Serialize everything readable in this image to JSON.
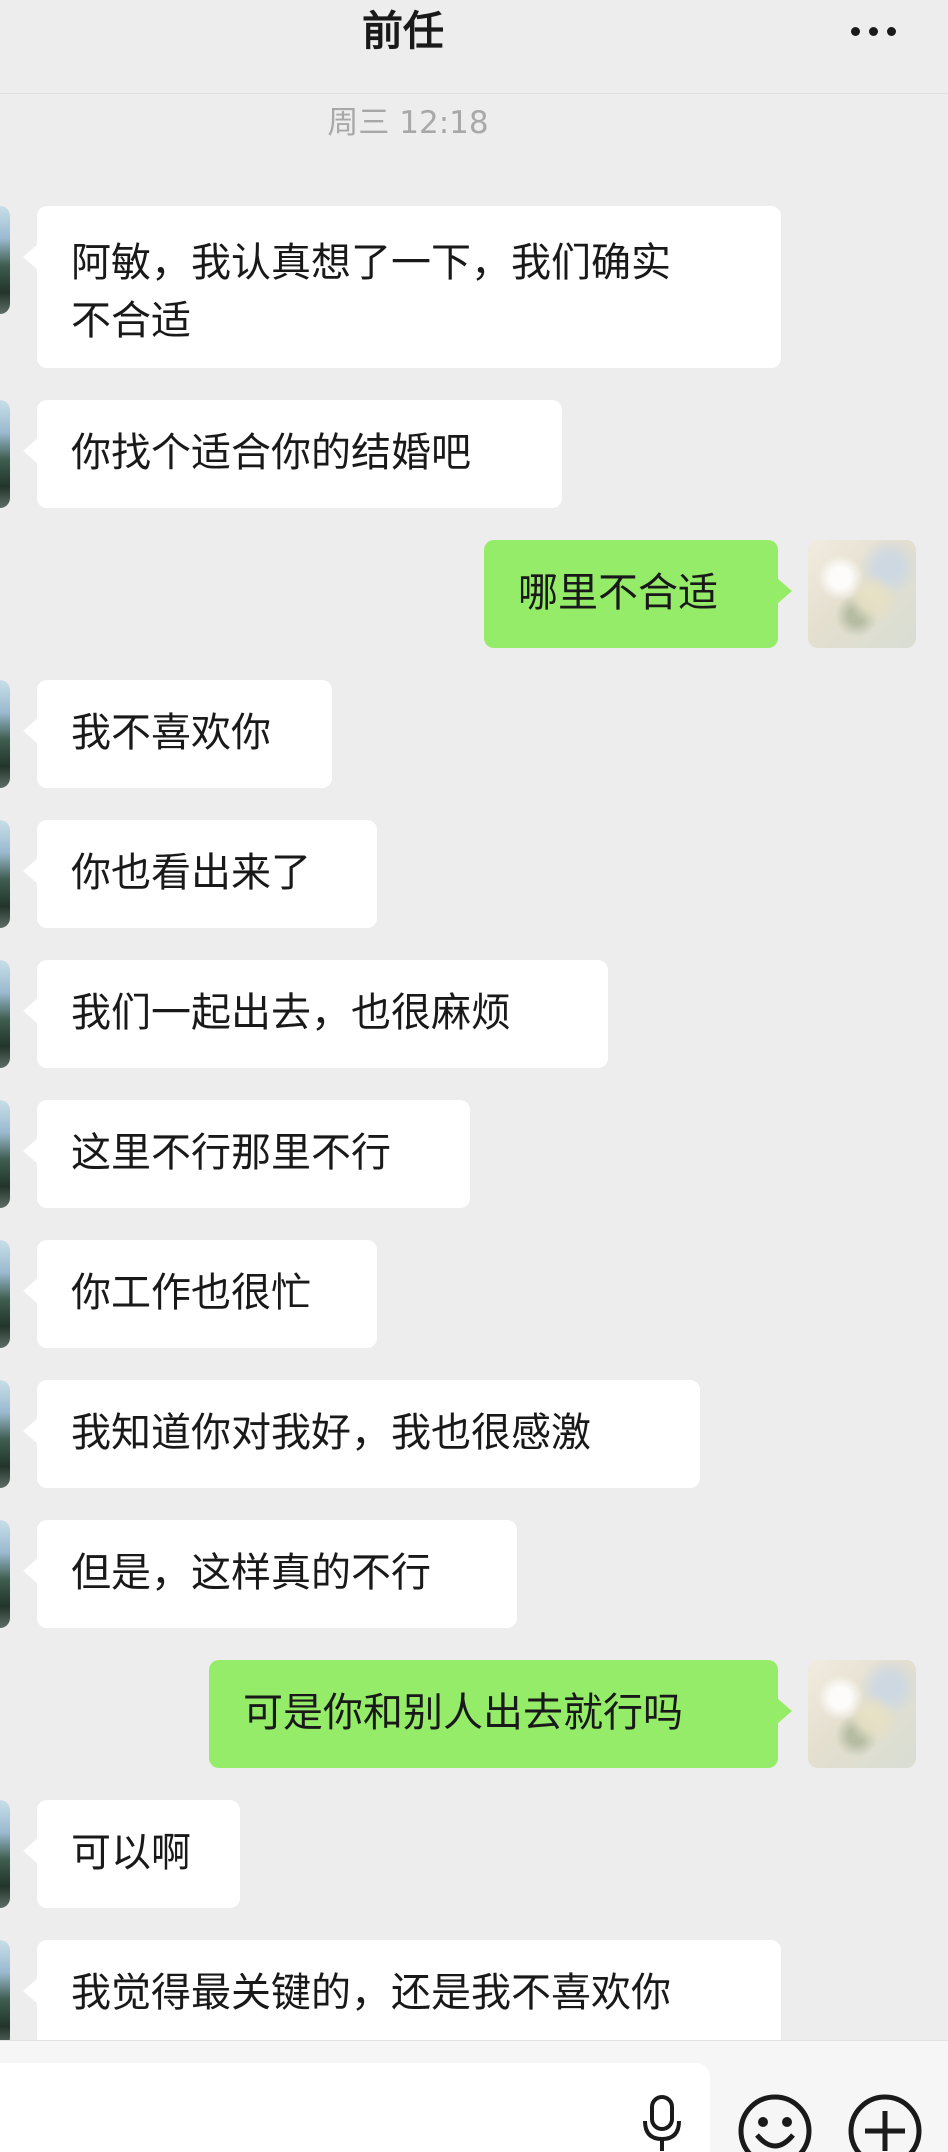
{
  "header": {
    "title": "前任",
    "more_icon": "more-horizontal-icon"
  },
  "timestamp": "周三 12:18",
  "messages": [
    {
      "side": "left",
      "lines": [
        "阿敏，我认真想了一下，我们确实",
        "不合适"
      ]
    },
    {
      "side": "left",
      "text": "你找个适合你的结婚吧"
    },
    {
      "side": "right",
      "text": "哪里不合适"
    },
    {
      "side": "left",
      "text": "我不喜欢你"
    },
    {
      "side": "left",
      "text": "你也看出来了"
    },
    {
      "side": "left",
      "text": "我们一起出去，也很麻烦"
    },
    {
      "side": "left",
      "text": "这里不行那里不行"
    },
    {
      "side": "left",
      "text": "你工作也很忙"
    },
    {
      "side": "left",
      "text": "我知道你对我好，我也很感激"
    },
    {
      "side": "left",
      "text": "但是，这样真的不行"
    },
    {
      "side": "right",
      "text": "可是你和别人出去就行吗"
    },
    {
      "side": "left",
      "text": "可以啊"
    },
    {
      "side": "left",
      "text": "我觉得最关键的，还是我不喜欢你"
    }
  ],
  "input_bar": {
    "voice_icon": "microphone-icon",
    "emoji_icon": "emoji-smile-icon",
    "plus_icon": "plus-circle-icon"
  },
  "colors": {
    "background": "#ededed",
    "incoming_bubble": "#ffffff",
    "outgoing_bubble": "#95ec69",
    "text": "#191919",
    "timestamp": "#a8a8a8"
  }
}
